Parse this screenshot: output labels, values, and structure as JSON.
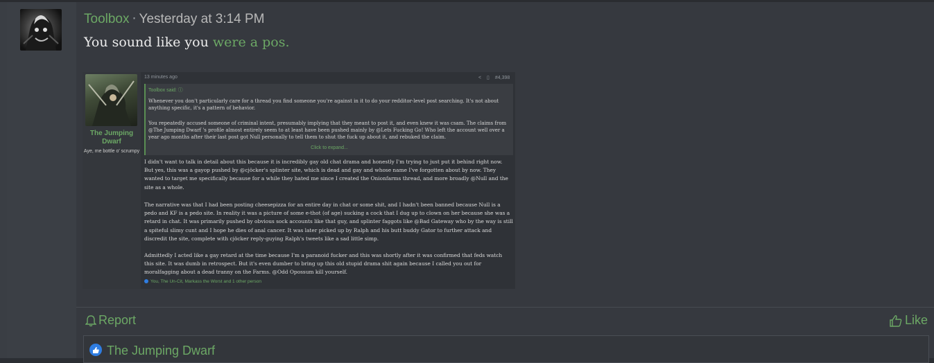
{
  "post": {
    "author": "Toolbox",
    "separator": "·",
    "timestamp": "Yesterday at 3:14 PM",
    "text": "You sound like you ",
    "link_text": "were a pos."
  },
  "embedded": {
    "author_name": "The Jumping Dwarf",
    "author_title": "Aye, me bottle o' scrumpy",
    "meta_time": "13 minutes ago",
    "post_number": "#4,398",
    "quote": {
      "header": "Toolbox said: ⓘ",
      "para1": "Whenever you don't particularly care for a thread you find someone you're against in it to do your redditor-level post searching. It's not about anything specific, it's a pattern of behavior.",
      "para2": "You repeatedly accused someone of criminal intent, presumably implying that they meant to post it, and even knew it was csam. The claims from @The Jumping Dwarf 's profile almost entirely seem to at least have been pushed mainly by @Lets Fucking Go! Who left the account well over a year ago months after their last post got Null personally to tell them to shut the fuck up about it, and rebuked the claim.",
      "expand": "Click to expand..."
    },
    "paragraphs": [
      "I didn't want to talk in detail about this because it is incredibly gay old chat drama and honestly I'm trying to just put it behind right now. But yes, this was a gayop pushed by @cjöcker's splinter site, which is dead and gay and whose name I've forgotten about by now. They wanted to target me specifically because for a while they hated me since I created the Onionfarms thread, and more broadly @Null and the site as a whole.",
      "The narrative was that I had been posting cheesepizza for an entire day in chat or some shit, and I hadn't been banned because Null is a pedo and KF is a pedo site. In reality it was a picture of some e-thot (of age) sucking a cock that I dug up to clown on her because she was a retard in chat. It was primarily pushed by obvious sock accounts like that guy, and splinter faggots like @Bad Gateway who by the way is still a spiteful slimy cunt and I hope he dies of anal cancer. It was later picked up by Ralph and his butt buddy Gator to further attack and discredit the site, complete with cjöcker reply-guying Ralph's tweets like a sad little simp.",
      "Admittedly I acted like a gay retard at the time because I'm a paranoid fucker and this was shortly after it was confirmed that feds watch this site. It was dumb in retrospect. But it's even dumber to bring up this old stupid drama shit again because I called you out for moralfagging about a dead tranny on the Farms. @Odd Opossum kill yourself."
    ],
    "reactions": "You, The Un-Cit, Markass the Worst and 1 other person"
  },
  "actions": {
    "report_label": "Report",
    "like_label": "Like"
  },
  "reaction_bar": {
    "name": "The Jumping Dwarf"
  },
  "colors": {
    "accent": "#6ca865",
    "background": "#36393f",
    "like_blue": "#2f7de1"
  }
}
